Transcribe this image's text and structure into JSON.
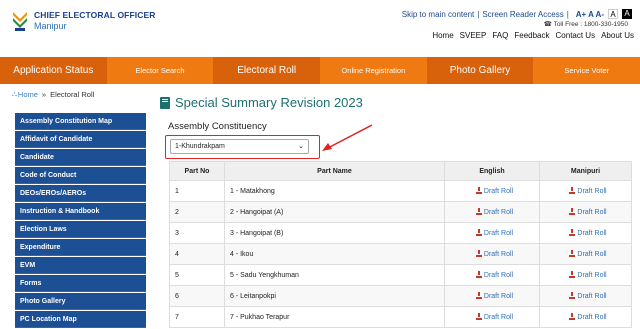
{
  "header": {
    "logo_title": "CHIEF ELECTORAL OFFICER",
    "logo_sub": "Manipur",
    "skip_link": "Skip to main content",
    "screen_reader": "Screen Reader Access",
    "font_ctrl": "A+ A A-",
    "contrast_light": "A",
    "contrast_dark": "A",
    "tollfree": "Toll Free : 1800-330-1950",
    "topnav": [
      "Home",
      "SVEEP",
      "FAQ",
      "Feedback",
      "Contact Us",
      "About Us"
    ]
  },
  "mainnav": [
    {
      "label": "Application Status",
      "style": "dark"
    },
    {
      "label": "Elector Search",
      "style": "light"
    },
    {
      "label": "Electoral Roll",
      "style": "dark"
    },
    {
      "label": "Online Registration",
      "style": "light"
    },
    {
      "label": "Photo Gallery",
      "style": "dark"
    },
    {
      "label": "Service Voter",
      "style": "light"
    }
  ],
  "breadcrumb": {
    "home": "Home",
    "sep": "»",
    "current": "Electoral Roll"
  },
  "sidebar": [
    "Assembly Constitution Map",
    "Affidavit of Candidate",
    "Candidate",
    "Code of Conduct",
    "DEOs/EROs/AEROs",
    "Instruction & Handbook",
    "Election Laws",
    "Expenditure",
    "EVM",
    "Forms",
    "Photo Gallery",
    "PC Location Map"
  ],
  "content": {
    "title": "Special Summary Revision 2023",
    "ac_label": "Assembly Constituency",
    "ac_selected": "1-Khundrakpam"
  },
  "table": {
    "headers": [
      "Part No",
      "Part Name",
      "English",
      "Manipuri"
    ],
    "link_label": "Draft Roll",
    "rows": [
      {
        "no": "1",
        "name": "1 - Matakhong"
      },
      {
        "no": "2",
        "name": "2 - Hangoipat (A)"
      },
      {
        "no": "3",
        "name": "3 - Hangoipat (B)"
      },
      {
        "no": "4",
        "name": "4 - Ikou"
      },
      {
        "no": "5",
        "name": "5 - Sadu Yengkhuman"
      },
      {
        "no": "6",
        "name": "6 - Leitanpokpi"
      },
      {
        "no": "7",
        "name": "7 - Pukhao Terapur"
      }
    ]
  },
  "colors": {
    "nav_dark": "#d8620b",
    "nav_light": "#ef7a12",
    "sidebar": "#1d4f94",
    "title": "#1e6f6f",
    "highlight": "#e02323"
  }
}
